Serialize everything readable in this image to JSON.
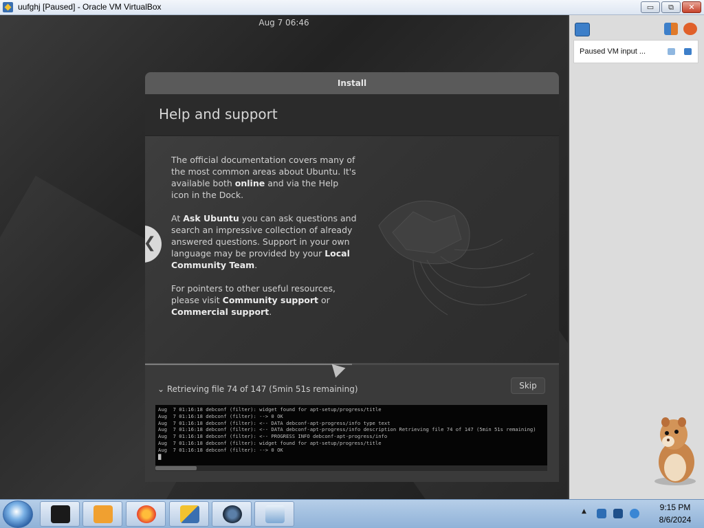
{
  "window": {
    "title": "uufghj [Paused] - Oracle VM VirtualBox",
    "minimize_label": "▭",
    "restore_label": "⧉",
    "close_label": "✕"
  },
  "guest": {
    "clock": "Aug 7  06:46",
    "installer": {
      "header": "Install",
      "slide_title": "Help and support",
      "prev_glyph": "❮",
      "paragraphs": [
        {
          "parts": [
            {
              "text": "The official documentation covers many of the most common areas about Ubuntu. It's available both ",
              "bold": false
            },
            {
              "text": "online",
              "bold": true
            },
            {
              "text": " and via the Help icon in the Dock.",
              "bold": false
            }
          ]
        },
        {
          "parts": [
            {
              "text": "At ",
              "bold": false
            },
            {
              "text": "Ask Ubuntu",
              "bold": true
            },
            {
              "text": " you can ask questions and search an impressive collection of already answered questions. Support in your own language may be provided by your ",
              "bold": false
            },
            {
              "text": "Local Community Team",
              "bold": true
            },
            {
              "text": ".",
              "bold": false
            }
          ]
        },
        {
          "parts": [
            {
              "text": "For pointers to other useful resources, please visit ",
              "bold": false
            },
            {
              "text": "Community support",
              "bold": true
            },
            {
              "text": " or ",
              "bold": false
            },
            {
              "text": "Commercial support",
              "bold": true
            },
            {
              "text": ".",
              "bold": false
            }
          ]
        }
      ],
      "progress": {
        "label": "⌄ Retrieving file 74 of 147 (5min 51s remaining)",
        "fraction": 0.5,
        "skip_label": "Skip"
      },
      "log_lines": [
        "Aug  7 01:16:18 debconf (filter): widget found for apt-setup/progress/title",
        "Aug  7 01:16:18 debconf (filter): --> 0 OK",
        "Aug  7 01:16:18 debconf (filter): <-- DATA debconf-apt-progress/info type text",
        "Aug  7 01:16:18 debconf (filter): <-- DATA debconf-apt-progress/info description Retrieving file 74 of 147 (5min 51s remaining)",
        "Aug  7 01:16:18 debconf (filter): <-- PROGRESS INFO debconf-apt-progress/info",
        "Aug  7 01:16:18 debconf (filter): widget found for apt-setup/progress/title",
        "Aug  7 01:16:18 debconf (filter): --> 0 OK",
        "█"
      ]
    }
  },
  "side_panel": {
    "notification": "Paused VM input ..."
  },
  "taskbar": {
    "tray_time": "9:15 PM",
    "tray_date": "8/6/2024",
    "tray_arrow": "▲"
  },
  "colors": {
    "accent": "#3a6fb0",
    "installer_bg": "#2c2c2c",
    "taskbar": "#a9c4e4"
  }
}
